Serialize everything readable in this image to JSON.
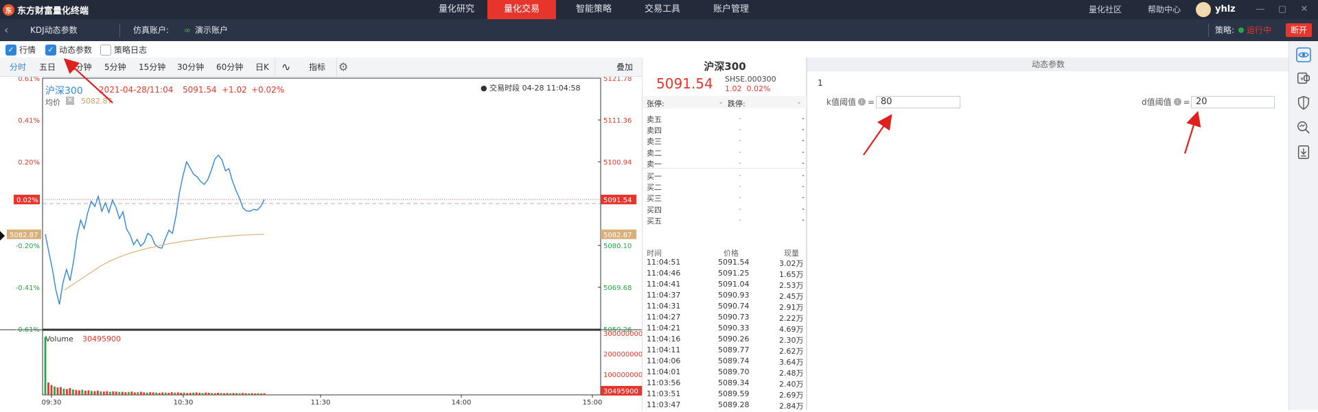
{
  "app": {
    "title": "东方财富量化终端",
    "logo_glyph": "东"
  },
  "nav": {
    "tabs": [
      "量化研究",
      "量化交易",
      "智能策略",
      "交易工具",
      "账户管理"
    ],
    "active_index": 1
  },
  "topright": {
    "community": "量化社区",
    "help": "帮助中心",
    "username": "yhlz",
    "win_min": "—",
    "win_max": "▢",
    "win_close": "✕"
  },
  "subbar": {
    "back": "‹",
    "strategy_title": "KDJ动态参数",
    "account_label": "仿真账户:",
    "account_value": "演示账户",
    "strategy_label": "策略:",
    "status": "运行中",
    "disconnect": "断开"
  },
  "toggles": [
    {
      "label": "行情",
      "checked": true
    },
    {
      "label": "动态参数",
      "checked": true
    },
    {
      "label": "策略日志",
      "checked": false
    }
  ],
  "period_tabs": [
    "分时",
    "五日",
    "1分钟",
    "5分钟",
    "15分钟",
    "30分钟",
    "60分钟",
    "日K"
  ],
  "period_active": 0,
  "indicator": {
    "label": "指标",
    "overlay": "叠加",
    "line_glyph": "∿",
    "settings_glyph": "⚙"
  },
  "chart_header": {
    "name": "沪深300",
    "time": "2021-04-28/11:04",
    "price": "5091.54",
    "change": "+1.02",
    "pct": "+0.02%",
    "avg_label": "均价",
    "avg_value": "5082.87",
    "session": "● 交易时段 04-28 11:04:58"
  },
  "chart_data": {
    "type": "line",
    "title": "沪深300",
    "x": [
      "09:30",
      "10:30",
      "11:30",
      "14:00",
      "15:00"
    ],
    "ylim": [
      5059.26,
      5121.78
    ],
    "y_ticks_price": [
      "5121.78",
      "5111.36",
      "5100.94",
      "5091.54",
      "5080.10",
      "5069.68",
      "5059.26"
    ],
    "y_ticks_pct": [
      "0.61%",
      "0.41%",
      "0.20%",
      "0.02%",
      "-0.20%",
      "-0.41%",
      "-0.61%"
    ],
    "base_price": 5090.52,
    "price_series": [
      5082.9,
      5078.5,
      5074.2,
      5069.0,
      5065.4,
      5070.8,
      5074.1,
      5071.3,
      5076.2,
      5082.5,
      5086.4,
      5084.3,
      5088.2,
      5091.1,
      5089.8,
      5092.3,
      5088.6,
      5090.7,
      5088.3,
      5091.4,
      5089.6,
      5086.8,
      5088.5,
      5084.2,
      5082.7,
      5080.3,
      5081.6,
      5079.9,
      5080.8,
      5083.1,
      5082.5,
      5080.4,
      5079.6,
      5079.4,
      5081.8,
      5083.9,
      5083.1,
      5087.5,
      5093.4,
      5097.6,
      5100.9,
      5099.4,
      5097.8,
      5097.2,
      5096.0,
      5095.3,
      5096.5,
      5098.8,
      5101.6,
      5102.6,
      5101.4,
      5098.7,
      5099.2,
      5096.1,
      5093.8,
      5091.8,
      5089.4,
      5088.7,
      5088.6,
      5089.1,
      5088.9,
      5089.8,
      5091.54
    ],
    "avg_series": [
      5069.0,
      5070.5,
      5072.0,
      5073.5,
      5075.0,
      5076.2,
      5077.2,
      5078.0,
      5078.7,
      5079.3,
      5079.8,
      5080.3,
      5080.7,
      5081.1,
      5081.4,
      5081.7,
      5082.0,
      5082.2,
      5082.4,
      5082.6,
      5082.7,
      5082.8,
      5082.87
    ],
    "volume_label": "Volume",
    "volume_value": "30495900",
    "volume_ticks": [
      "300000000",
      "200000000",
      "100000000"
    ],
    "volume_series": [
      280,
      60,
      48,
      40,
      36,
      38,
      30,
      28,
      33,
      26,
      24,
      22,
      25,
      20,
      22,
      19,
      18,
      21,
      17,
      16,
      18,
      15,
      17,
      16,
      14,
      15,
      13,
      14,
      16,
      12,
      13,
      15,
      12,
      11,
      13,
      12,
      11,
      10,
      12,
      11,
      10,
      13,
      11,
      12,
      10,
      11,
      9,
      10,
      11,
      12,
      10,
      9,
      11,
      10,
      9,
      8,
      10,
      9,
      8,
      9,
      8,
      9,
      8,
      8,
      9,
      8,
      7,
      8,
      7,
      8,
      7,
      8
    ],
    "volume_colors": [
      "#28a745",
      "#e5352d"
    ]
  },
  "quote": {
    "name": "沪深300",
    "price": "5091.54",
    "code": "SHSE.000300",
    "change": "1.02",
    "pct": "0.02%",
    "limit_up_label": "张停:",
    "limit_up_value": "-",
    "limit_down_label": "跌停:",
    "limit_down_value": "-",
    "orderbook": [
      {
        "label": "卖五",
        "price": "-",
        "vol": "-"
      },
      {
        "label": "卖四",
        "price": "-",
        "vol": "-"
      },
      {
        "label": "卖三",
        "price": "-",
        "vol": "-"
      },
      {
        "label": "卖二",
        "price": "-",
        "vol": "-"
      },
      {
        "label": "卖一",
        "price": "-",
        "vol": "-"
      },
      {
        "label": "买一",
        "price": "-",
        "vol": "-"
      },
      {
        "label": "买二",
        "price": "-",
        "vol": "-"
      },
      {
        "label": "买三",
        "price": "-",
        "vol": "-"
      },
      {
        "label": "买四",
        "price": "-",
        "vol": "-"
      },
      {
        "label": "买五",
        "price": "-",
        "vol": "-"
      }
    ],
    "tick_headers": [
      "时间",
      "价格",
      "现量"
    ],
    "ticks": [
      [
        "11:04:51",
        "5091.54",
        "3.02万"
      ],
      [
        "11:04:46",
        "5091.25",
        "1.65万"
      ],
      [
        "11:04:41",
        "5091.04",
        "2.53万"
      ],
      [
        "11:04:37",
        "5090.93",
        "2.45万"
      ],
      [
        "11:04:31",
        "5090.74",
        "2.91万"
      ],
      [
        "11:04:27",
        "5090.73",
        "2.22万"
      ],
      [
        "11:04:21",
        "5090.33",
        "4.69万"
      ],
      [
        "11:04:16",
        "5090.26",
        "2.30万"
      ],
      [
        "11:04:11",
        "5089.77",
        "2.62万"
      ],
      [
        "11:04:06",
        "5089.74",
        "3.64万"
      ],
      [
        "11:04:01",
        "5089.70",
        "2.48万"
      ],
      [
        "11:03:56",
        "5089.34",
        "2.40万"
      ],
      [
        "11:03:51",
        "5089.59",
        "2.69万"
      ],
      [
        "11:03:47",
        "5089.28",
        "2.84万"
      ]
    ]
  },
  "dynamic_params": {
    "title": "动态参数",
    "index": "1",
    "k_label": "k值阈值",
    "k_value": "80",
    "d_label": "d值阈值",
    "d_value": "20",
    "info_glyph": "i",
    "eq": "="
  },
  "side_icons": [
    "eye-icon",
    "wallet-icon",
    "shield-icon",
    "search-chart-icon",
    "download-doc-icon"
  ],
  "colors": {
    "accent_red": "#e5352d",
    "up": "#e5352d",
    "down": "#28a745",
    "line": "#2f86d8",
    "avg": "#d9b07a",
    "arrow": "#e0201c"
  }
}
